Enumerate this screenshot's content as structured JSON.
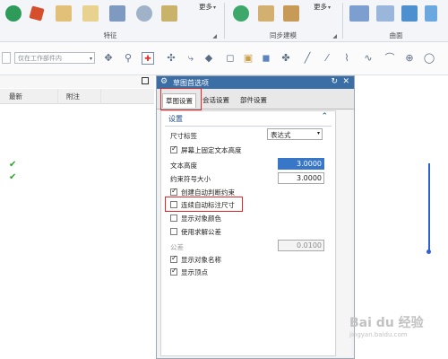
{
  "ribbon": {
    "groups": [
      {
        "label": "特征",
        "more": "更多"
      },
      {
        "label": "同步建模",
        "more": "更多"
      },
      {
        "label": "曲面"
      }
    ]
  },
  "toolbar": {
    "combo1_value": "",
    "combo2_value": "仅在工作部件内"
  },
  "nav": {
    "col_latest": "最新",
    "col_note": "附注",
    "checks": [
      "✔",
      "✔"
    ]
  },
  "dialog": {
    "title": "草图首选项",
    "tabs": [
      "草图设置",
      "会话设置",
      "部件设置"
    ],
    "section": "设置",
    "dim_label": {
      "label": "尺寸标签",
      "value": "表达式"
    },
    "fixed_text_height": {
      "label": "屏幕上固定文本高度",
      "checked": true
    },
    "text_height": {
      "label": "文本高度",
      "value": "3.0000"
    },
    "constraint_symbol_size": {
      "label": "约束符号大小",
      "value": "3.0000"
    },
    "create_auto_constraints": {
      "label": "创建自动判断约束",
      "checked": true
    },
    "continuous_auto_dimension": {
      "label": "连续自动标注尺寸",
      "checked": false
    },
    "show_object_color": {
      "label": "显示对象颜色",
      "checked": false
    },
    "use_solver_tolerance": {
      "label": "使用求解公差",
      "checked": false
    },
    "tolerance": {
      "label": "公差",
      "value": "0.0100"
    },
    "show_object_name": {
      "label": "显示对象名称",
      "checked": true
    },
    "show_vertices": {
      "label": "显示顶点",
      "checked": true
    }
  },
  "watermark": {
    "brand": "Bai du 经验",
    "url": "jingyan.baidu.com"
  },
  "colors": {
    "accent": "#3a6ea5",
    "highlight": "#e0272a",
    "selection": "#3877c8",
    "check_green": "#2aa52a"
  }
}
